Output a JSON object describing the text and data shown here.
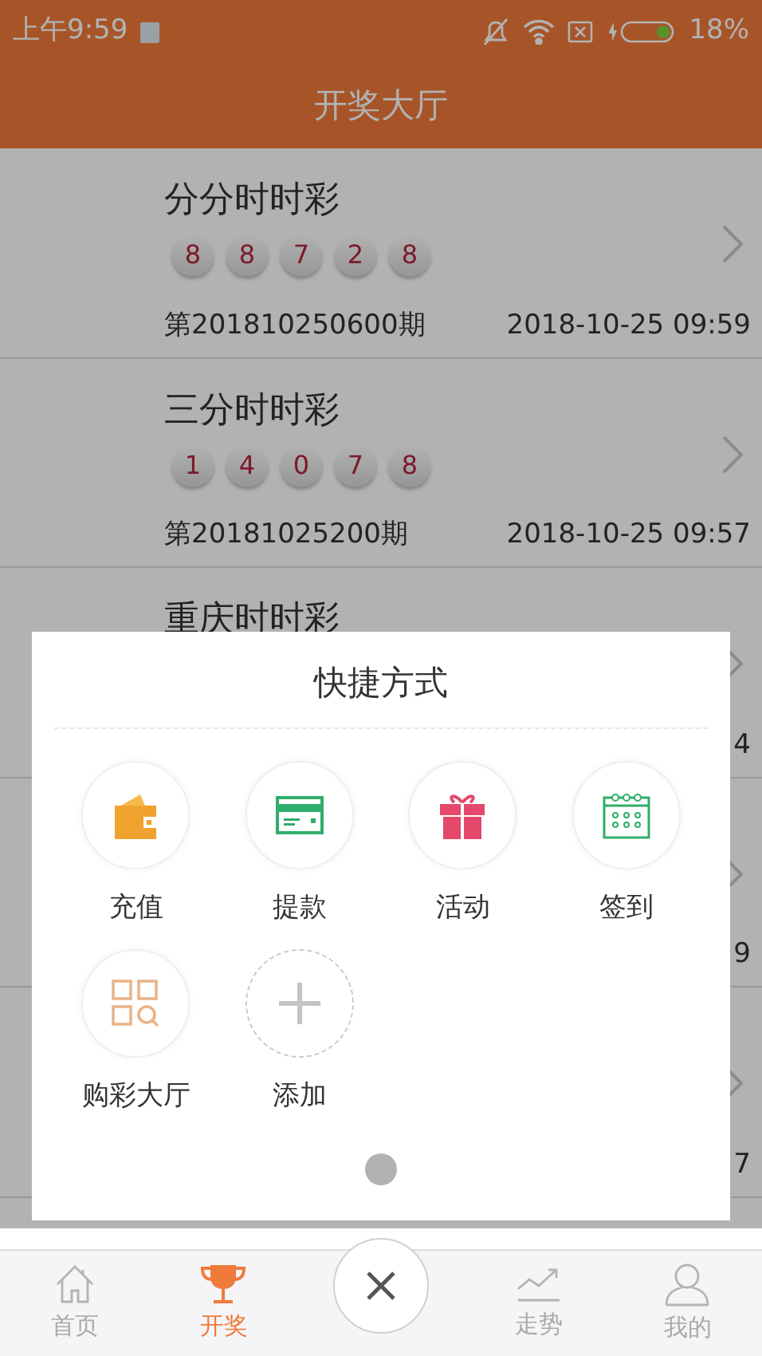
{
  "status_bar": {
    "time": "上午9:59",
    "battery": "18%"
  },
  "header": {
    "title": "开奖大厅"
  },
  "draws": [
    {
      "name": "分分时时彩",
      "numbers": [
        "8",
        "8",
        "7",
        "2",
        "8"
      ],
      "issue": "第201810250600期",
      "time": "2018-10-25 09:59"
    },
    {
      "name": "三分时时彩",
      "numbers": [
        "1",
        "4",
        "0",
        "7",
        "8"
      ],
      "issue": "第20181025200期",
      "time": "2018-10-25 09:57"
    },
    {
      "name": "重庆时时彩",
      "time": "4"
    },
    {
      "time": "9"
    },
    {
      "time": "7"
    }
  ],
  "shortcuts": {
    "title": "快捷方式",
    "items": [
      {
        "kind": "wallet",
        "label": "充值"
      },
      {
        "kind": "card",
        "label": "提款"
      },
      {
        "kind": "gift",
        "label": "活动"
      },
      {
        "kind": "calendar",
        "label": "签到"
      },
      {
        "kind": "grid",
        "label": "购彩大厅"
      },
      {
        "kind": "add",
        "label": "添加"
      }
    ]
  },
  "tabs": [
    {
      "kind": "home",
      "label": "首页",
      "selected": false
    },
    {
      "kind": "trophy",
      "label": "开奖",
      "selected": true
    },
    {
      "kind": "trend",
      "label": "走势",
      "selected": false
    },
    {
      "kind": "user",
      "label": "我的",
      "selected": false
    }
  ]
}
